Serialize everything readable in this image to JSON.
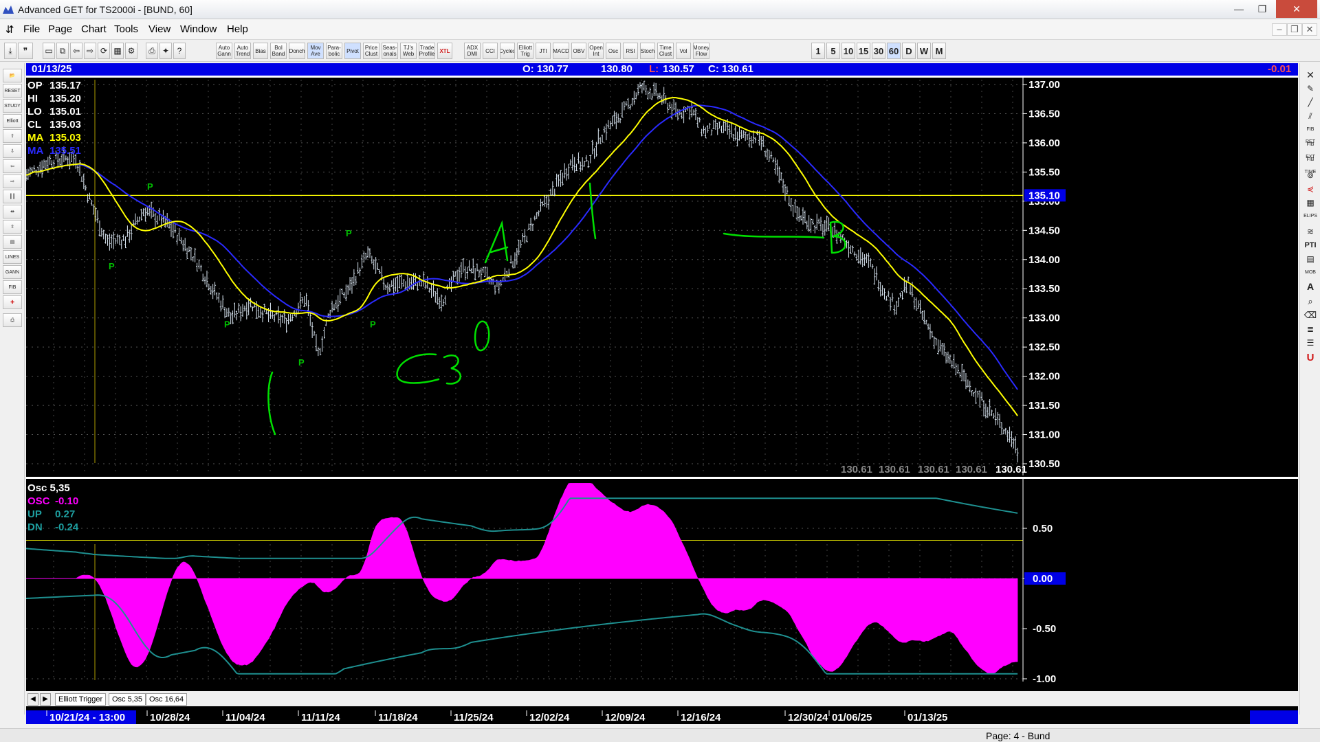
{
  "window": {
    "title": "Advanced GET for TS2000i - [BUND, 60]",
    "minimize": "—",
    "maximize": "❐",
    "close": "✕"
  },
  "menu": [
    "File",
    "Page",
    "Chart",
    "Tools",
    "View",
    "Window",
    "Help"
  ],
  "toolbar": {
    "buttons": [
      "Auto Gann",
      "Auto Trend",
      "Bias",
      "Bol Band",
      "Donch",
      "Mov Ave",
      "Para- bolic",
      "Pivot",
      "Price Clust",
      "Seas- onals",
      "TJ's Web",
      "Trade Profile",
      "XTL",
      "ADX DMI",
      "CCI",
      "Cycles",
      "Elliott Trig",
      "JTI",
      "MACD",
      "OBV",
      "Open Int",
      "Osc",
      "RSI",
      "Stoch",
      "Time Clust",
      "Vol",
      "Money Flow"
    ],
    "timeframes": [
      "1",
      "5",
      "10",
      "15",
      "30",
      "60",
      "D",
      "W",
      "M"
    ],
    "active_timeframe": "60"
  },
  "left_tools": [
    "RESET",
    "STUDY",
    "Elliott",
    "LINES",
    "GANN",
    "FIB"
  ],
  "right_tools": [
    "FIB RET",
    "FIB EXT",
    "FIB TIME",
    "ELIPS",
    "PTI",
    "MOB"
  ],
  "header": {
    "date": "01/13/25",
    "open": "O: 130.77",
    "high": "130.80",
    "low_label": "L:",
    "low": "130.57",
    "close": "C: 130.61",
    "change": "-0.01"
  },
  "info": {
    "op_label": "OP",
    "op": "135.17",
    "hi_label": "HI",
    "hi": "135.20",
    "lo_label": "LO",
    "lo": "135.01",
    "cl_label": "CL",
    "cl": "135.03",
    "ma1_label": "MA",
    "ma1": "135.03",
    "ma2_label": "MA",
    "ma2": "135.51"
  },
  "osc_info": {
    "title": "Osc 5,35",
    "osc_label": "OSC",
    "osc": "-0.10",
    "up_label": "UP",
    "up": "0.27",
    "dn_label": "DN",
    "dn": "-0.24"
  },
  "price_axis": {
    "ticks": [
      "137.00",
      "136.50",
      "136.00",
      "135.50",
      "135.00",
      "134.50",
      "134.00",
      "133.50",
      "133.00",
      "132.50",
      "132.00",
      "131.50",
      "131.00",
      "130.50"
    ],
    "highlight": "135.10"
  },
  "price_readouts": [
    "130.61",
    "130.61",
    "130.61",
    "130.61",
    "130.61"
  ],
  "osc_axis": {
    "ticks": [
      "0.50",
      "0.00",
      "-0.50",
      "-1.00"
    ],
    "highlight": "0.00"
  },
  "time_axis": [
    "10/21/24 - 13:00",
    "10/28/24",
    "11/04/24",
    "11/11/24",
    "11/18/24",
    "11/25/24",
    "12/02/24",
    "12/09/24",
    "12/16/24",
    "12/30/24",
    "01/06/25",
    "01/13/25"
  ],
  "pivot_marker": "P",
  "annotations": {
    "wave_a": "A",
    "wave_b": "B",
    "note_30": "30"
  },
  "tabs": [
    "Elliott Trigger",
    "Osc 5,35",
    "Osc 16,64"
  ],
  "tab_nav": [
    "◀",
    "▶"
  ],
  "status": "Page: 4 - Bund",
  "colors": {
    "header_blue": "#0000e6",
    "price_bars": "#d8e4f0",
    "ma_fast": "#ffff00",
    "ma_slow": "#2a2aff",
    "osc_fill": "#ff00ff",
    "band_line": "#1e9090",
    "annotation": "#00e000",
    "pivot": "#00c000"
  }
}
